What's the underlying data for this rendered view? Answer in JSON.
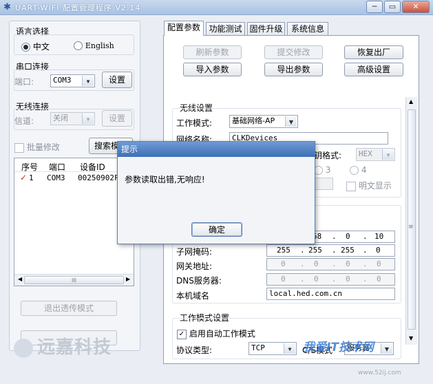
{
  "window": {
    "title": "UART-WIFI 配置管理程序 V2.14",
    "min_label": "─",
    "max_label": "▭",
    "close_label": "✕"
  },
  "left": {
    "language": {
      "title": "语言选择",
      "option_cn": "中文",
      "option_en": "English",
      "selected": "中文"
    },
    "serial": {
      "title": "串口连接",
      "port_label": "端口:",
      "port_value": "COM3",
      "set_button": "设置"
    },
    "wireless": {
      "title": "无线连接",
      "channel_label": "信道:",
      "channel_value": "关闭",
      "set_button": "设置"
    },
    "batch_modify": "批量修改",
    "search_button": "搜索模块",
    "device_list": {
      "headers": [
        "序号",
        "端口",
        "设备ID"
      ],
      "rows": [
        {
          "check": "✓",
          "index": "1",
          "port": "COM3",
          "device_id": "00250902F0"
        }
      ],
      "hscroll_mid": "III"
    },
    "exit_passthrough": "退出透传模式",
    "brand": "远嘉科技"
  },
  "tabs": [
    "配置参数",
    "功能测试",
    "固件升级",
    "系统信息"
  ],
  "actions": {
    "refresh": "刷新参数",
    "submit": "提交修改",
    "factory": "恢复出厂",
    "import": "导入参数",
    "export": "导出参数",
    "advanced": "高级设置"
  },
  "wireless_settings": {
    "title": "无线设置",
    "mode_label": "工作模式:",
    "mode_value": "基础网络-AP",
    "ssid_label": "网络名称:",
    "ssid_value": "CLKDevices",
    "key_format_label": "钥格式:",
    "key_format_value": "HEX",
    "key_index_3": "3",
    "key_index_4": "4",
    "plaintext_label": "明文显示"
  },
  "network": {
    "ip_partial": [
      "58",
      "0",
      "10"
    ],
    "subnet_label": "子网掩码:",
    "subnet": [
      "255",
      "255",
      "255",
      "0"
    ],
    "gateway_label": "网关地址:",
    "gateway": [
      "0",
      "0",
      "0",
      "0"
    ],
    "dns_label": "DNS服务器:",
    "dns": [
      "0",
      "0",
      "0",
      "0"
    ],
    "domain_label": "本机域名",
    "domain_value": "local.hed.com.cn"
  },
  "work_mode": {
    "title": "工作模式设置",
    "auto_label": "启用自动工作模式",
    "protocol_label": "协议类型:",
    "protocol_value": "TCP",
    "cs_label": "C/S模式",
    "cs_value": "服务器"
  },
  "dialog": {
    "title": "提示",
    "message": "参数读取出错,无响应!",
    "ok": "确定"
  },
  "watermark": {
    "text": "我爱IT技术网",
    "url": "www.52ij.com"
  }
}
